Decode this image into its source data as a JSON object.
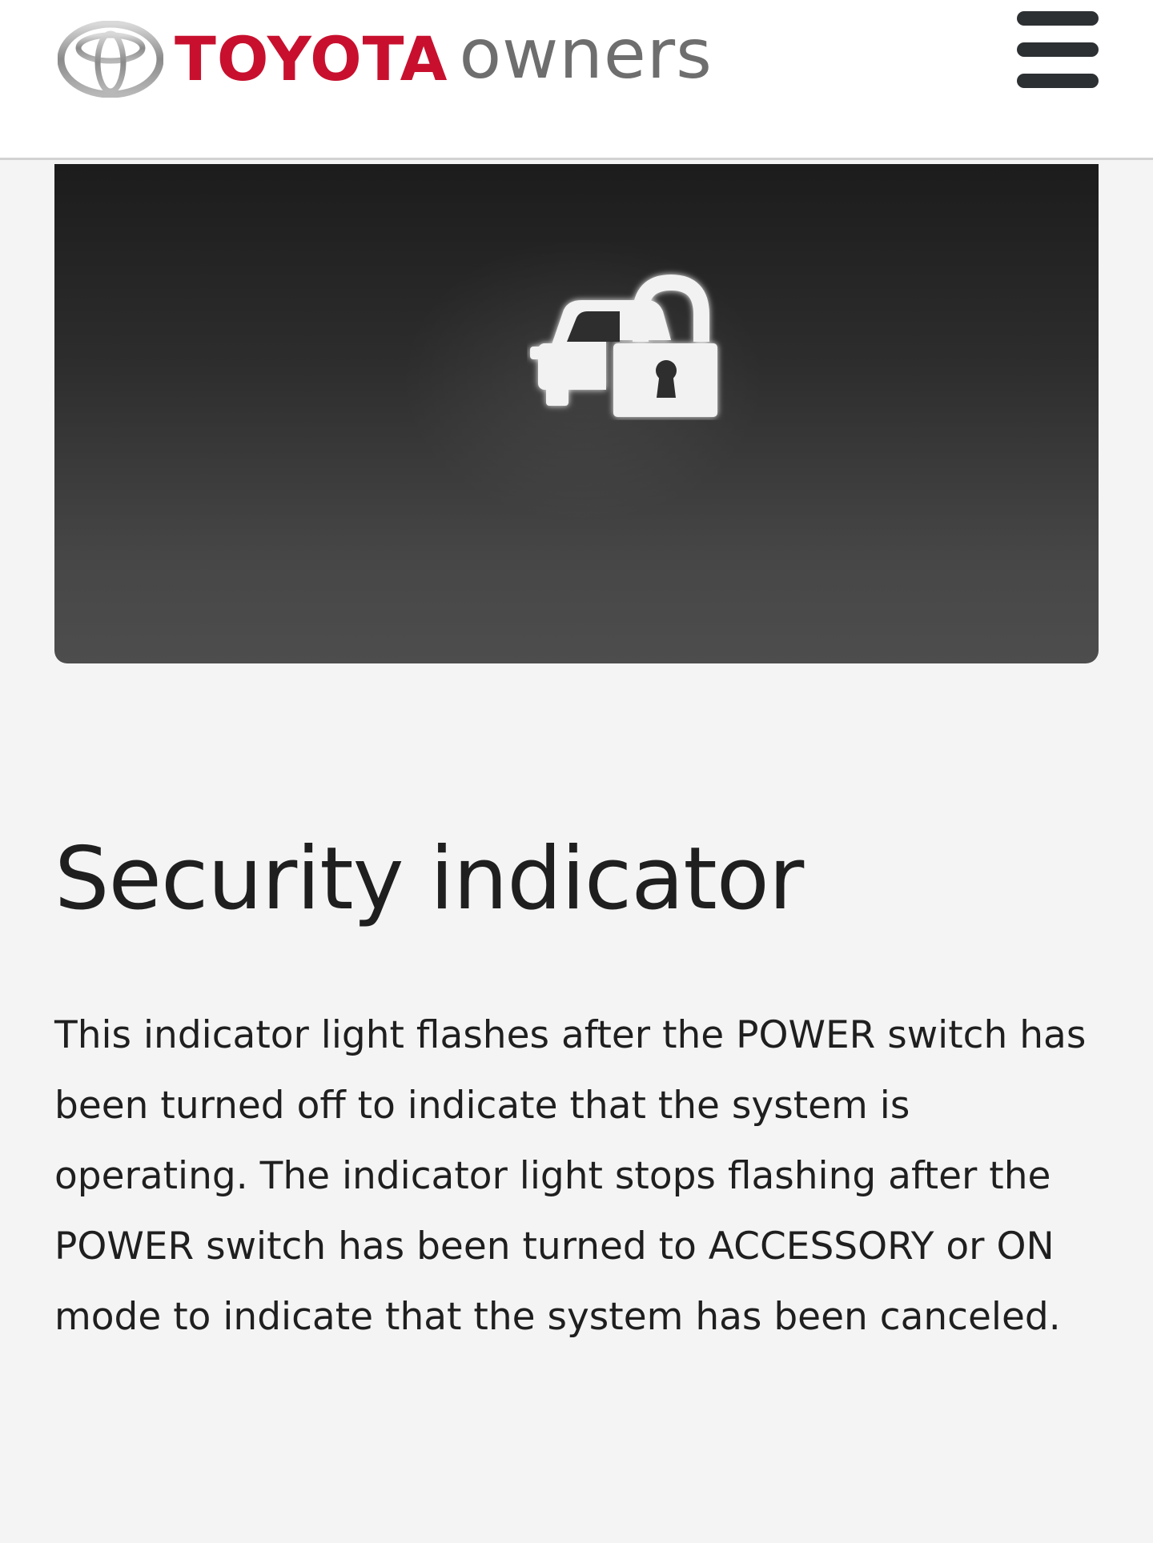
{
  "colors": {
    "brand_red": "#c8102e",
    "owners_gray": "#6e6e6e",
    "menu_icon": "#2d3033",
    "text": "#1f1f1f",
    "page_bg": "#f4f4f4",
    "icon_glow": "#ffffff"
  },
  "header": {
    "logo": {
      "emblem_icon": "toyota-emblem-icon",
      "brand": "TOYOTA",
      "product": "owners"
    },
    "menu_icon": "hamburger-menu-icon"
  },
  "hero": {
    "icon": "security-indicator-car-lock-icon"
  },
  "article": {
    "title": "Security indicator",
    "body": "This indicator light flashes after the POWER switch has been turned off to indicate that the system is operating. The indicator light stops flashing after the POWER switch has been turned to ACCESSORY or ON mode to indicate that the system has been canceled."
  }
}
